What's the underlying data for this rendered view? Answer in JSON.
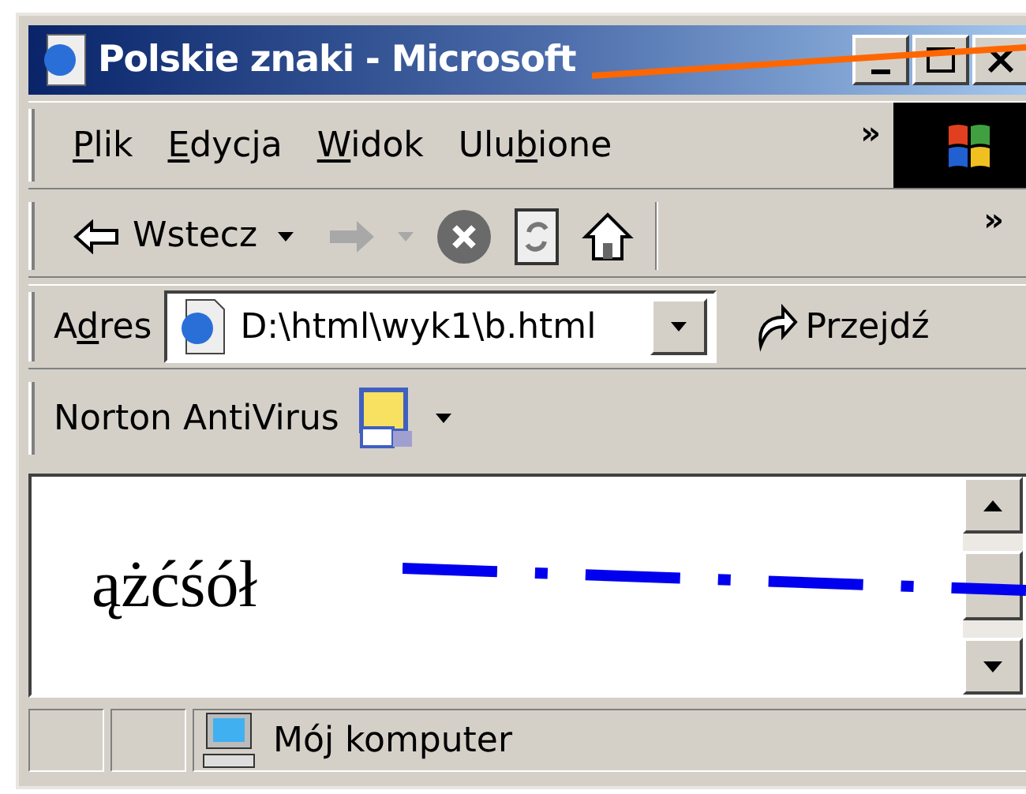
{
  "window": {
    "title": "Polskie znaki - Microsoft"
  },
  "menu": [
    {
      "key": "P",
      "rest": "lik"
    },
    {
      "key": "E",
      "rest": "dycja"
    },
    {
      "key": "W",
      "rest": "idok"
    },
    {
      "pre": "Ulu",
      "key": "b",
      "rest": "ione"
    }
  ],
  "toolbar": {
    "back": "Wstecz",
    "more": "»"
  },
  "menu_more": "»",
  "address": {
    "label_pre": "A",
    "label_key": "d",
    "label_rest": "res",
    "value": "D:\\html\\wyk1\\b.html",
    "go": "Przejdź"
  },
  "norton": {
    "label": "Norton AntiVirus"
  },
  "content": {
    "text": "ążćśół"
  },
  "status_bar": {
    "zone": "Mój komputer"
  }
}
